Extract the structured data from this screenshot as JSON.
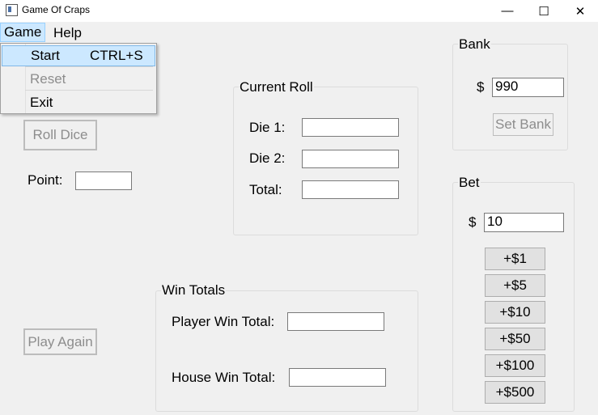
{
  "window": {
    "title": "Game Of Craps",
    "minimize": "—",
    "maximize": "☐",
    "close": "✕"
  },
  "menu": {
    "items": [
      {
        "label": "Game"
      },
      {
        "label": "Help"
      }
    ],
    "game_dropdown": [
      {
        "label": "Start",
        "shortcut": "CTRL+S"
      },
      {
        "label": "Reset"
      },
      {
        "label": "Exit"
      }
    ]
  },
  "main": {
    "roll_dice_label": "Roll Dice",
    "point_label": "Point:",
    "point_value": "",
    "play_again_label": "Play Again"
  },
  "current_roll": {
    "title": "Current Roll",
    "die1_label": "Die 1:",
    "die1_value": "",
    "die2_label": "Die 2:",
    "die2_value": "",
    "total_label": "Total:",
    "total_value": ""
  },
  "win_totals": {
    "title": "Win Totals",
    "player_label": "Player Win Total:",
    "player_value": "",
    "house_label": "House Win Total:",
    "house_value": ""
  },
  "bank": {
    "title": "Bank",
    "currency": "$",
    "value": "990",
    "set_bank_label": "Set Bank"
  },
  "bet": {
    "title": "Bet",
    "currency": "$",
    "value": "10",
    "buttons": [
      "+$1",
      "+$5",
      "+$10",
      "+$50",
      "+$100",
      "+$500"
    ]
  }
}
